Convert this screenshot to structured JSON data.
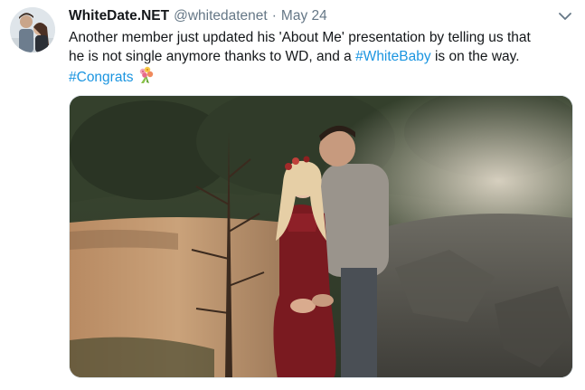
{
  "tweet": {
    "display_name": "WhiteDate.NET",
    "handle": "@whitedatenet",
    "separator": "·",
    "date": "May 24",
    "text": {
      "line1": "Another member just updated his 'About Me' presentation by telling us that",
      "line2_before": "he is not single anymore thanks to WD, and a ",
      "hashtag1": "#WhiteBaby",
      "line2_after": " is on the way.",
      "hashtag2": "#Congrats"
    },
    "emoji": "bouquet-icon",
    "media": {
      "description_icon": "photo"
    }
  },
  "colors": {
    "link": "#1b95e0",
    "secondary_text": "#657786",
    "primary_text": "#14171a"
  }
}
